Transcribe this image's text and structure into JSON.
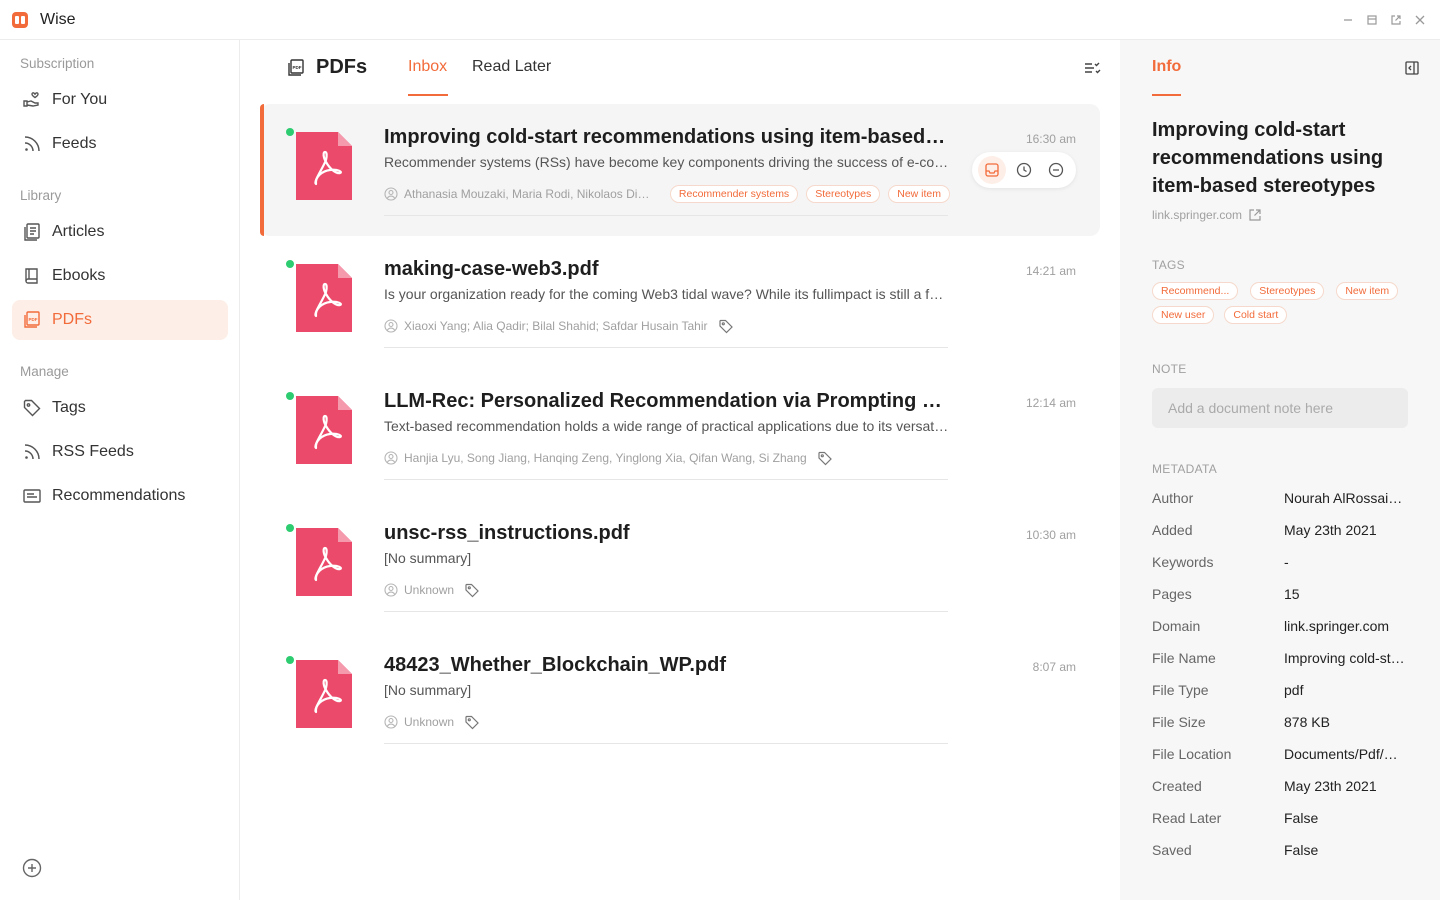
{
  "app": {
    "title": "Wise",
    "accent": "#f26b3a"
  },
  "sidebar": {
    "sections": {
      "subscription": "Subscription",
      "library": "Library",
      "manage": "Manage"
    },
    "items": [
      {
        "label": "For You",
        "icon": "hand-heart-icon"
      },
      {
        "label": "Feeds",
        "icon": "rss-icon"
      },
      {
        "label": "Articles",
        "icon": "articles-icon"
      },
      {
        "label": "Ebooks",
        "icon": "book-icon"
      },
      {
        "label": "PDFs",
        "icon": "pdf-icon",
        "active": true
      },
      {
        "label": "Tags",
        "icon": "tag-icon"
      },
      {
        "label": "RSS Feeds",
        "icon": "rss-icon"
      },
      {
        "label": "Recommendations",
        "icon": "recommendations-icon"
      }
    ]
  },
  "main": {
    "title": "PDFs",
    "tabs": [
      {
        "label": "Inbox",
        "active": true
      },
      {
        "label": "Read Later"
      }
    ],
    "documents": [
      {
        "title": "Improving cold-start recommendations using item-based stereotypes",
        "summary": "Recommender systems (RSs) have become key components driving the success of e-commerce and other platforms",
        "authors": "Athanasia Mouzaki, Maria Rodi, Nikolaos Dimisianos",
        "tags": [
          "Recommender systems",
          "Stereotypes",
          "New item"
        ],
        "time": "16:30 am"
      },
      {
        "title": "making-case-web3.pdf",
        "summary": "Is your organization ready for the coming Web3 tidal wave? While its fullimpact is still a few years away",
        "authors": "Xiaoxi Yang; Alia Qadir; Bilal Shahid; Safdar Husain Tahir",
        "tags": [],
        "time": "14:21 am"
      },
      {
        "title": "LLM-Rec: Personalized Recommendation via Prompting Large Language Models",
        "summary": "Text-based recommendation holds a wide range of practical applications due to its versatility",
        "authors": "Hanjia Lyu, Song Jiang, Hanqing Zeng, Yinglong Xia, Qifan Wang, Si Zhang",
        "tags": [],
        "time": "12:14 am"
      },
      {
        "title": "unsc-rss_instructions.pdf",
        "summary": "[No summary]",
        "authors": "Unknown",
        "tags": [],
        "time": "10:30 am"
      },
      {
        "title": "48423_Whether_Blockchain_WP.pdf",
        "summary": "[No summary]",
        "authors": "Unknown",
        "tags": [],
        "time": "8:07 am"
      }
    ]
  },
  "info": {
    "tab": "Info",
    "title": "Improving cold-start recommendations using item-based stereotypes",
    "domain": "link.springer.com",
    "tags_label": "TAGS",
    "tags": [
      "Recommender systems",
      "Stereotypes",
      "New item",
      "New user",
      "Cold start"
    ],
    "tags_display": [
      "Recommend...",
      "Stereotypes",
      "New item",
      "New user",
      "Cold start"
    ],
    "note_label": "NOTE",
    "note_placeholder": "Add a document note here",
    "metadata_label": "METADATA",
    "metadata": [
      {
        "key": "Author",
        "value": "Nourah AlRossais, Dimitar Kazakov"
      },
      {
        "key": "Added",
        "value": "May 23th 2021"
      },
      {
        "key": "Keywords",
        "value": "-"
      },
      {
        "key": "Pages",
        "value": "15"
      },
      {
        "key": "Domain",
        "value": "link.springer.com"
      },
      {
        "key": "File Name",
        "value": "Improving cold-start recommendations.pdf"
      },
      {
        "key": "File Type",
        "value": "pdf"
      },
      {
        "key": "File Size",
        "value": "878 KB"
      },
      {
        "key": "File Location",
        "value": "Documents/Pdf/Wise"
      },
      {
        "key": "Created",
        "value": "May 23th 2021"
      },
      {
        "key": "Read Later",
        "value": "False"
      },
      {
        "key": "Saved",
        "value": "False"
      }
    ]
  }
}
